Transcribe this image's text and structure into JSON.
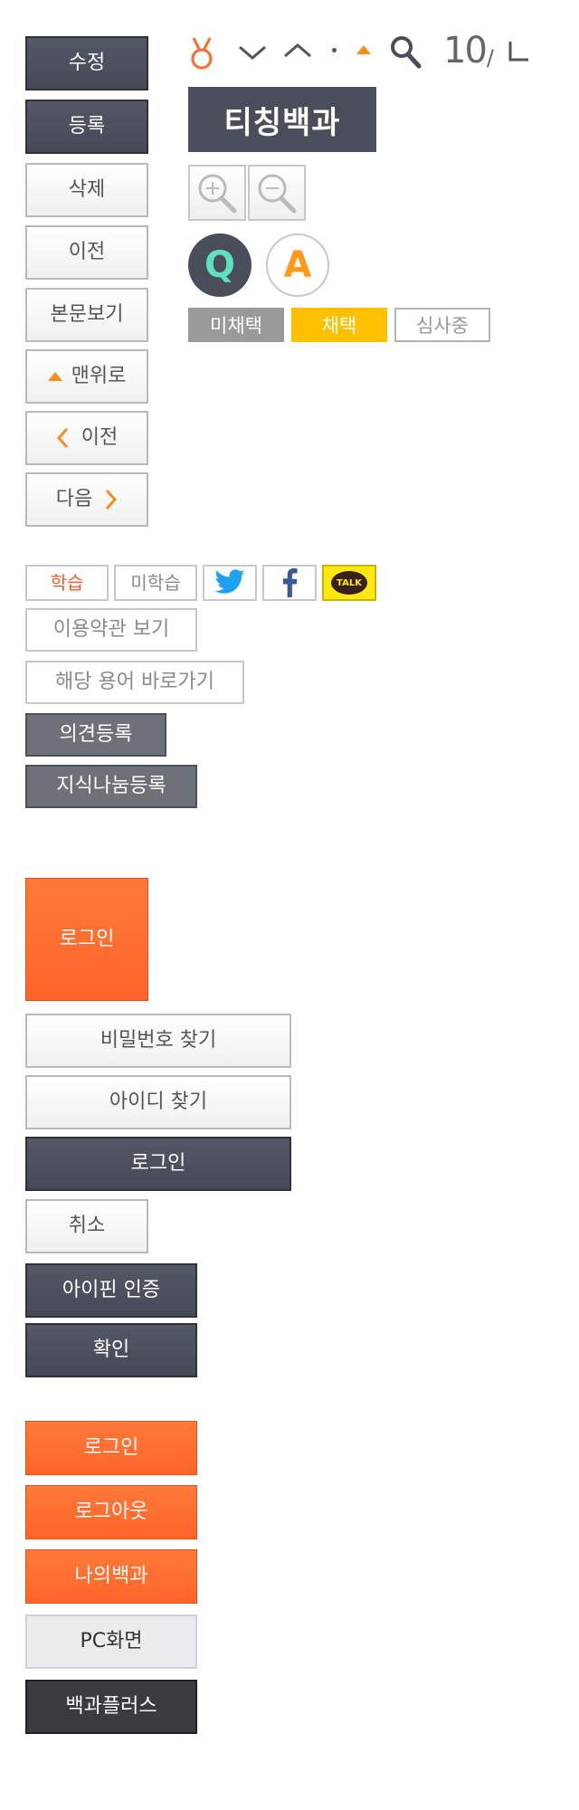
{
  "left_buttons": {
    "edit": "수정",
    "register": "등록",
    "delete": "삭제",
    "prev_plain": "이전",
    "view_body": "본문보기",
    "to_top": "맨위로",
    "prev": "이전",
    "next": "다음"
  },
  "top_icons": {
    "page_number": "10",
    "page_separator": "/",
    "logo_text": "티칭백과"
  },
  "qa": {
    "q": "Q",
    "a": "A"
  },
  "status_tags": {
    "not_adopted": "미채택",
    "adopted": "채택",
    "reviewing": "심사중"
  },
  "study": {
    "learned": "학습",
    "not_learned": "미학습",
    "talk": "TALK"
  },
  "links": {
    "terms": "이용약관 보기",
    "go_term": "해당 용어 바로가기",
    "opinion": "의견등록",
    "knowledge": "지식나눔등록"
  },
  "login_section": {
    "big_login": "로그인",
    "find_password": "비밀번호 찾기",
    "find_id": "아이디 찾기",
    "login": "로그인",
    "cancel": "취소",
    "ipin": "아이핀 인증",
    "confirm": "확인"
  },
  "bottom_menu": {
    "login": "로그인",
    "logout": "로그아웃",
    "my": "나의백과",
    "pc": "PC화면",
    "plus": "백과플러스"
  },
  "colors": {
    "orange": "#ff6a2b",
    "dark": "#4a4e5a",
    "yellow": "#ffc000",
    "teal": "#5fe0c0",
    "twitter": "#1da1f2",
    "facebook": "#3b5998",
    "kakao": "#ffe812"
  }
}
